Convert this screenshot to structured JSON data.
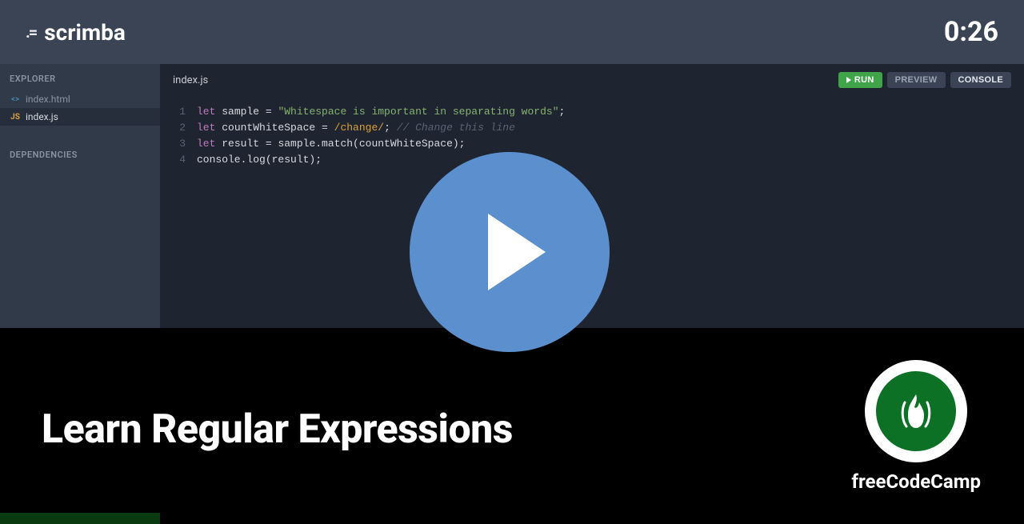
{
  "topbar": {
    "brand": "scrimba",
    "timer": "0:26"
  },
  "sidebar": {
    "explorer_label": "EXPLORER",
    "dependencies_label": "DEPENDENCIES",
    "files": [
      {
        "name": "index.html",
        "icon": "<>",
        "active": false
      },
      {
        "name": "index.js",
        "icon": "JS",
        "active": true
      }
    ]
  },
  "editor": {
    "active_tab": "index.js",
    "buttons": {
      "run": "RUN",
      "preview": "PREVIEW",
      "console": "CONSOLE"
    },
    "code_lines": [
      {
        "n": "1",
        "tokens": [
          {
            "t": "let ",
            "c": "kw"
          },
          {
            "t": "sample ",
            "c": "var"
          },
          {
            "t": "= ",
            "c": "op"
          },
          {
            "t": "\"Whitespace is important in separating words\"",
            "c": "str"
          },
          {
            "t": ";",
            "c": "punc"
          }
        ]
      },
      {
        "n": "2",
        "tokens": [
          {
            "t": "let ",
            "c": "kw"
          },
          {
            "t": "countWhiteSpace ",
            "c": "var"
          },
          {
            "t": "= ",
            "c": "op"
          },
          {
            "t": "/change/",
            "c": "regex"
          },
          {
            "t": "; ",
            "c": "punc"
          },
          {
            "t": "// Change this line",
            "c": "comment"
          }
        ]
      },
      {
        "n": "3",
        "tokens": [
          {
            "t": "let ",
            "c": "kw"
          },
          {
            "t": "result ",
            "c": "var"
          },
          {
            "t": "= ",
            "c": "op"
          },
          {
            "t": "sample.match(countWhiteSpace);",
            "c": "fn"
          }
        ]
      },
      {
        "n": "4",
        "tokens": [
          {
            "t": "console.log(result);",
            "c": "fn"
          }
        ]
      }
    ],
    "console_label": "CONSOLE"
  },
  "overlay": {
    "lesson_title": "Learn Regular Expressions",
    "fcc_label": "freeCodeCamp"
  }
}
